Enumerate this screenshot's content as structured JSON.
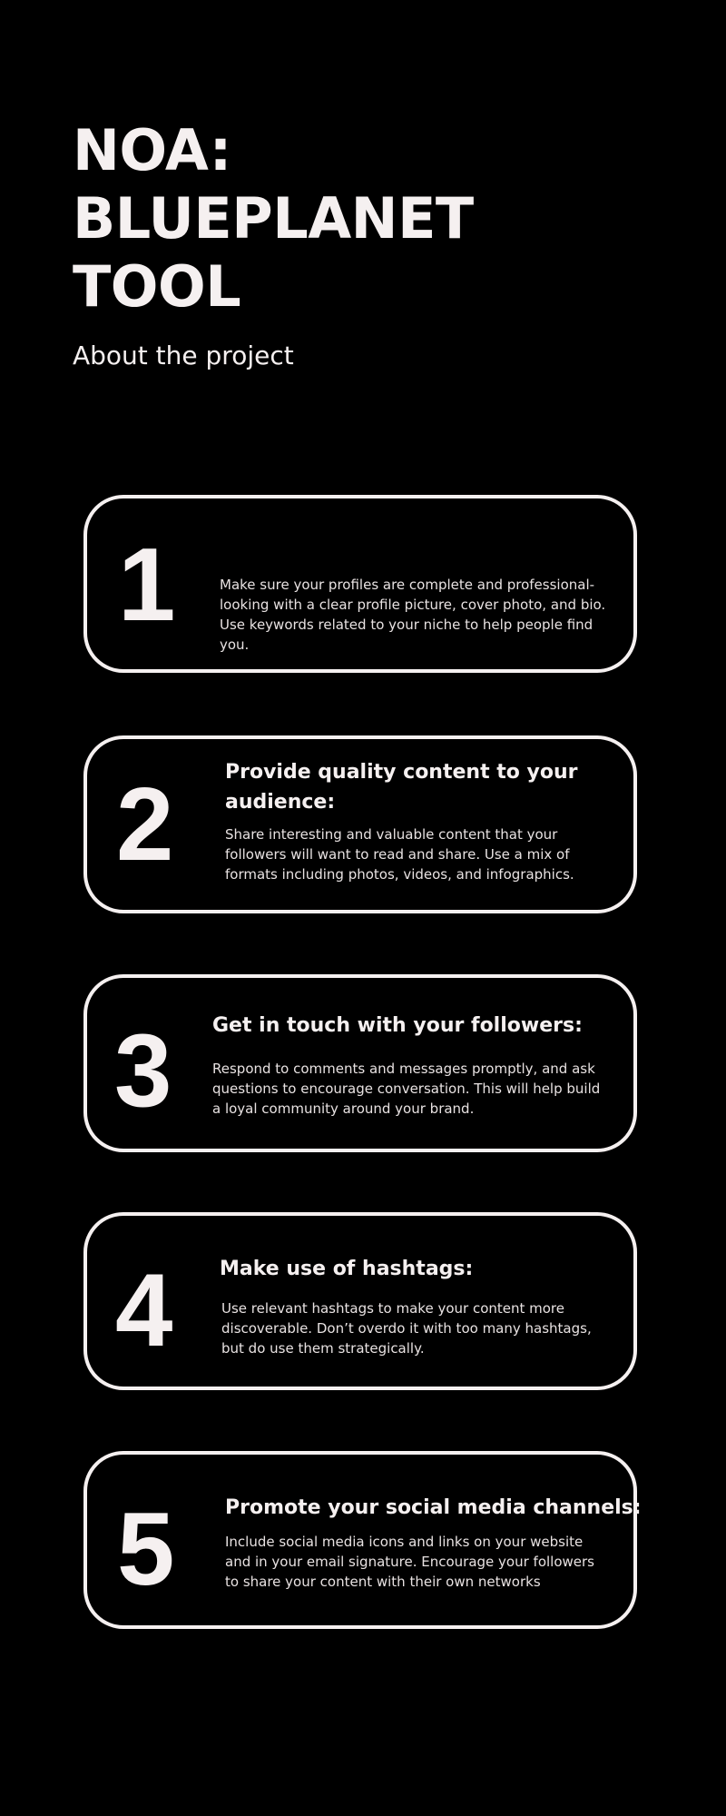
{
  "header": {
    "title_lines": [
      "NOA:",
      "BLUEPLANET",
      "TOOL"
    ],
    "subtitle": "About the project"
  },
  "cards": [
    {
      "number": "1",
      "heading": "",
      "body": "Make sure your profiles are complete and professional-looking with a clear profile picture, cover photo, and bio. Use keywords related to your niche to help people find you."
    },
    {
      "number": "2",
      "heading": "Provide quality content to your audience:",
      "body": " Share interesting and valuable content that your followers will want to read and share. Use a mix of formats including photos, videos, and infographics."
    },
    {
      "number": "3",
      "heading": "Get in touch with your followers:",
      "body": "Respond to comments and messages promptly, and ask questions to encourage conversation. This will help build a loyal community around your brand."
    },
    {
      "number": "4",
      "heading": "Make use of hashtags:",
      "body": "Use relevant hashtags to make your content more discoverable. Don’t overdo it with too many hashtags, but do use them strategically."
    },
    {
      "number": "5",
      "heading": "Promote your social media channels:",
      "body": " Include social media icons and links on your website and in your email signature. Encourage your followers to share your content with their own networks"
    }
  ],
  "colors": {
    "background": "#000000",
    "foreground": "#f5f0f0"
  }
}
